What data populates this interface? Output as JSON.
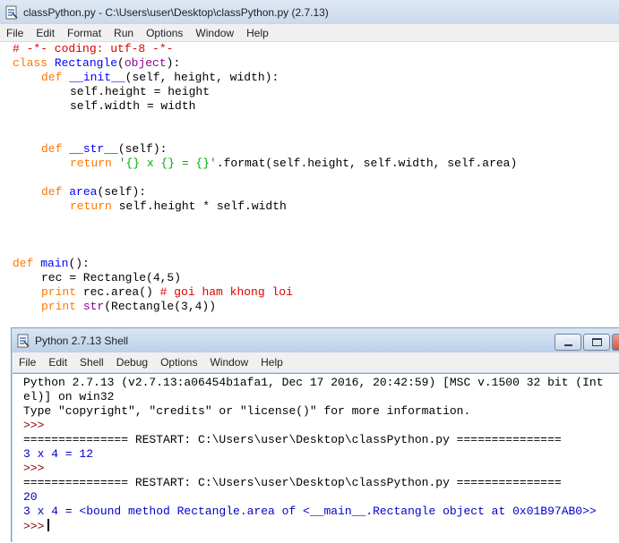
{
  "editor": {
    "title": "classPython.py - C:\\Users\\user\\Desktop\\classPython.py (2.7.13)",
    "menu": [
      "File",
      "Edit",
      "Format",
      "Run",
      "Options",
      "Window",
      "Help"
    ],
    "code": {
      "l1": "# -*- coding: utf-8 -*-",
      "l2_kw": "class ",
      "l2_name": "Rectangle",
      "l2_open": "(",
      "l2_bi": "object",
      "l2_close": "):",
      "l3_kw": "def ",
      "l3_name": "__init__",
      "l3_rest": "(self, height, width):",
      "l4": "self.height = height",
      "l5": "self.width = width",
      "l6_kw": "def ",
      "l6_name": "__str__",
      "l6_rest": "(self):",
      "l7_kw": "return ",
      "l7_str": "'{} x {} = {}'",
      "l7_rest": ".format(self.height, self.width, self.area)",
      "l8_kw": "def ",
      "l8_name": "area",
      "l8_rest": "(self):",
      "l9_kw": "return ",
      "l9_rest": "self.height * self.width",
      "l10_kw": "def ",
      "l10_name": "main",
      "l10_rest": "():",
      "l11": "rec = Rectangle(4,5)",
      "l12_kw": "print ",
      "l12_rest": "rec.area() ",
      "l12_cm": "# goi ham khong loi",
      "l13_kw": "print ",
      "l13_bi": "str",
      "l13_rest": "(Rectangle(3,4))"
    }
  },
  "shell": {
    "title": "Python 2.7.13 Shell",
    "menu": [
      "File",
      "Edit",
      "Shell",
      "Debug",
      "Options",
      "Window",
      "Help"
    ],
    "lines": {
      "o1": "Python 2.7.13 (v2.7.13:a06454b1afa1, Dec 17 2016, 20:42:59) [MSC v.1500 32 bit (Int",
      "o2": "el)] on win32",
      "o3": "Type \"copyright\", \"credits\" or \"license()\" for more information.",
      "o4": ">>>",
      "o5": "=============== RESTART: C:\\Users\\user\\Desktop\\classPython.py ===============",
      "o6": "3 x 4 = 12",
      "o7": ">>>",
      "o8": "=============== RESTART: C:\\Users\\user\\Desktop\\classPython.py ===============",
      "o9": "20",
      "o10": "3 x 4 = <bound method Rectangle.area of <__main__.Rectangle object at 0x01B97AB0>>",
      "o11": ">>>"
    }
  }
}
